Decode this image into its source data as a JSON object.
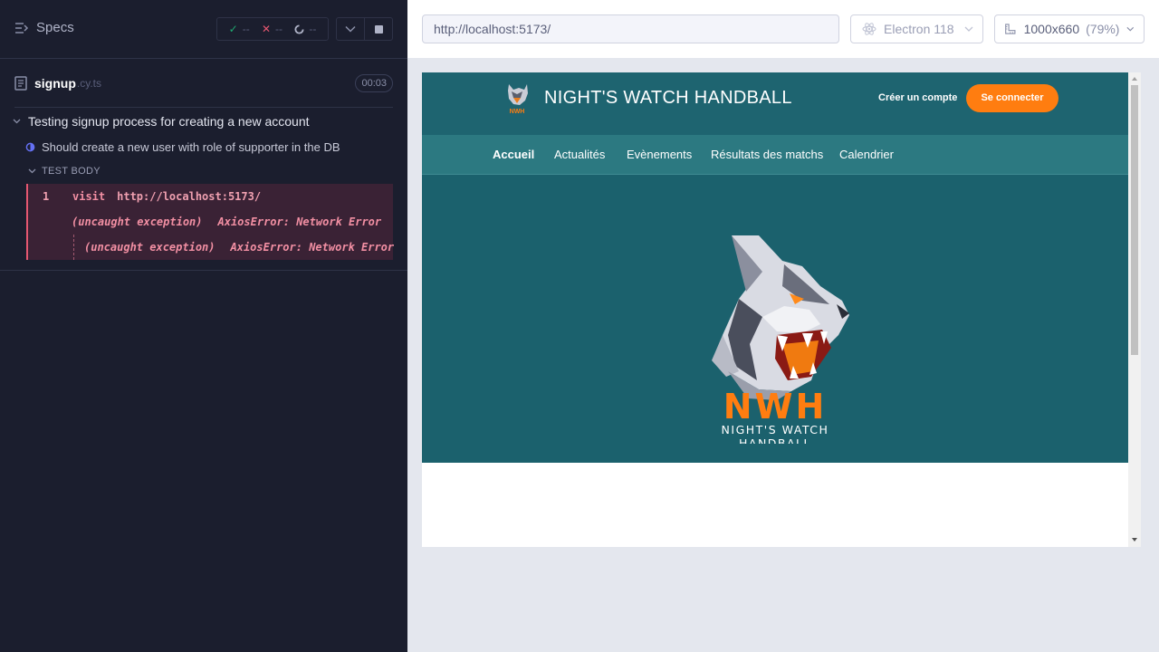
{
  "reporter": {
    "specs_label": "Specs",
    "stats": {
      "passed": "--",
      "failed": "--",
      "pending": "--"
    },
    "spec_file": {
      "name": "signup",
      "ext": ".cy.ts",
      "duration": "00:03"
    },
    "suite_title": "Testing signup process for creating a new account",
    "test_title": "Should create a new user with role of supporter in the DB",
    "section_label": "TEST BODY",
    "commands": [
      {
        "num": "1",
        "name": "visit",
        "message": "http://localhost:5173/"
      },
      {
        "name": "(uncaught exception)",
        "message": "AxiosError: Network Error"
      },
      {
        "name": "(uncaught exception)",
        "message": "AxiosError: Network Error"
      }
    ]
  },
  "topbar": {
    "url": "http://localhost:5173/",
    "browser": "Electron 118",
    "viewport": "1000x660",
    "zoom": "(79%)"
  },
  "site": {
    "title": "NIGHT'S WATCH HANDBALL",
    "signup_link": "Créer un compte",
    "login_button": "Se connecter",
    "nav": [
      "Accueil",
      "Actualités",
      "Evènements",
      "Résultats des matchs",
      "Calendrier"
    ],
    "logo": {
      "abbr": "NWH",
      "line1": "NIGHT'S WATCH",
      "line2": "HANDBALL"
    }
  },
  "colors": {
    "reporter_bg": "#1b1e2e",
    "header_teal": "#1e6470",
    "nav_teal": "#2c7981",
    "accent_orange": "#ff7d10",
    "error_pink": "#e45770"
  }
}
